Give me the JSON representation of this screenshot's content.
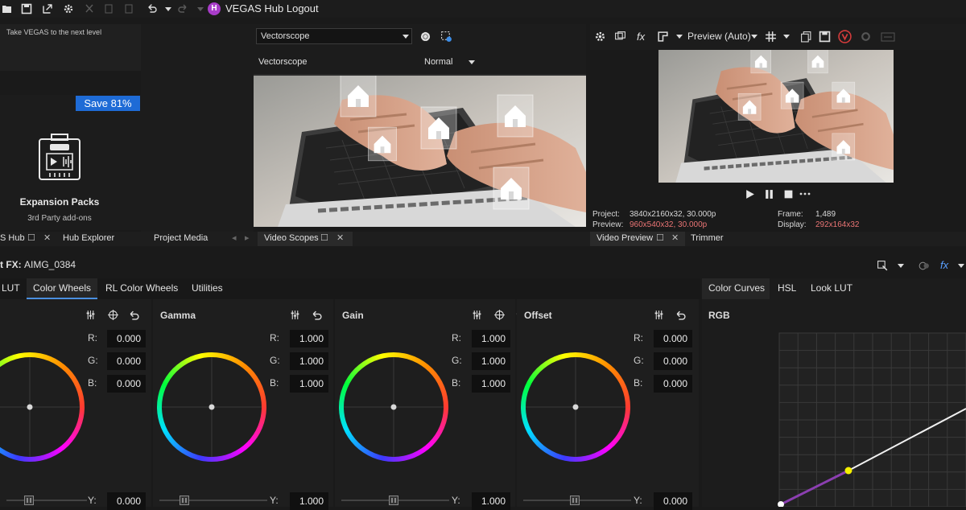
{
  "toolbar": {
    "hub_initial": "H",
    "hub_title": "VEGAS Hub Logout"
  },
  "hub": {
    "promo": "Take VEGAS to the next level",
    "badge": "Save 81%",
    "pack_title": "Expansion Packs",
    "pack_subtitle": "3rd Party add-ons"
  },
  "scope": {
    "select_value": "Vectorscope",
    "mode_label": "Vectorscope",
    "mode_value": "Normal"
  },
  "preview": {
    "quality": "Preview (Auto)",
    "project_label": "Project:",
    "project_value": "3840x2160x32, 30.000p",
    "preview_label": "Preview:",
    "preview_value": "960x540x32, 30.000p",
    "frame_label": "Frame:",
    "frame_value": "1,489",
    "display_label": "Display:",
    "display_value": "292x164x32"
  },
  "docks": {
    "hub": "S Hub",
    "hub_explorer": "Hub Explorer",
    "project_media": "Project Media",
    "video_scopes": "Video Scopes",
    "video_preview": "Video Preview",
    "trimmer": "Trimmer"
  },
  "fx": {
    "title": "t FX:",
    "clip": "AIMG_0384"
  },
  "fx_tabs": [
    "LUT",
    "Color Wheels",
    "RL Color Wheels",
    "Utilities"
  ],
  "wheels": [
    {
      "title": "",
      "r": "0.000",
      "g": "0.000",
      "b": "0.000",
      "y": "0.000"
    },
    {
      "title": "Gamma",
      "r": "1.000",
      "g": "1.000",
      "b": "1.000",
      "y": "1.000"
    },
    {
      "title": "Gain",
      "r": "1.000",
      "g": "1.000",
      "b": "1.000",
      "y": "1.000"
    },
    {
      "title": "Offset",
      "r": "0.000",
      "g": "0.000",
      "b": "0.000",
      "y": "0.000"
    }
  ],
  "channel_labels": {
    "r": "R:",
    "g": "G:",
    "b": "B:",
    "y": "Y:"
  },
  "curve_tabs": [
    "Color Curves",
    "HSL",
    "Look LUT"
  ],
  "curve": {
    "channel": "RGB",
    "accent": "#8b3fb0",
    "point": "#f5f000"
  }
}
